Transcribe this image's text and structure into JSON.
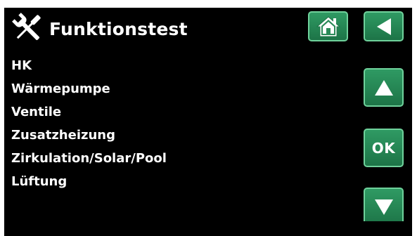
{
  "header": {
    "title": "Funktionstest",
    "title_icon": "tools-icon"
  },
  "menu": {
    "items": [
      {
        "label": "HK"
      },
      {
        "label": "Wärmepumpe"
      },
      {
        "label": "Ventile"
      },
      {
        "label": "Zusatzheizung"
      },
      {
        "label": "Zirkulation/Solar/Pool"
      },
      {
        "label": "Lüftung"
      }
    ]
  },
  "buttons": {
    "home_icon": "home-icon",
    "back_icon": "back-arrow-icon",
    "up_icon": "arrow-up-icon",
    "ok_label": "OK",
    "down_icon": "arrow-down-icon"
  },
  "colors": {
    "background": "#000000",
    "button_fill": "#2a8a57",
    "button_border": "#6fd19b",
    "text": "#ffffff"
  }
}
